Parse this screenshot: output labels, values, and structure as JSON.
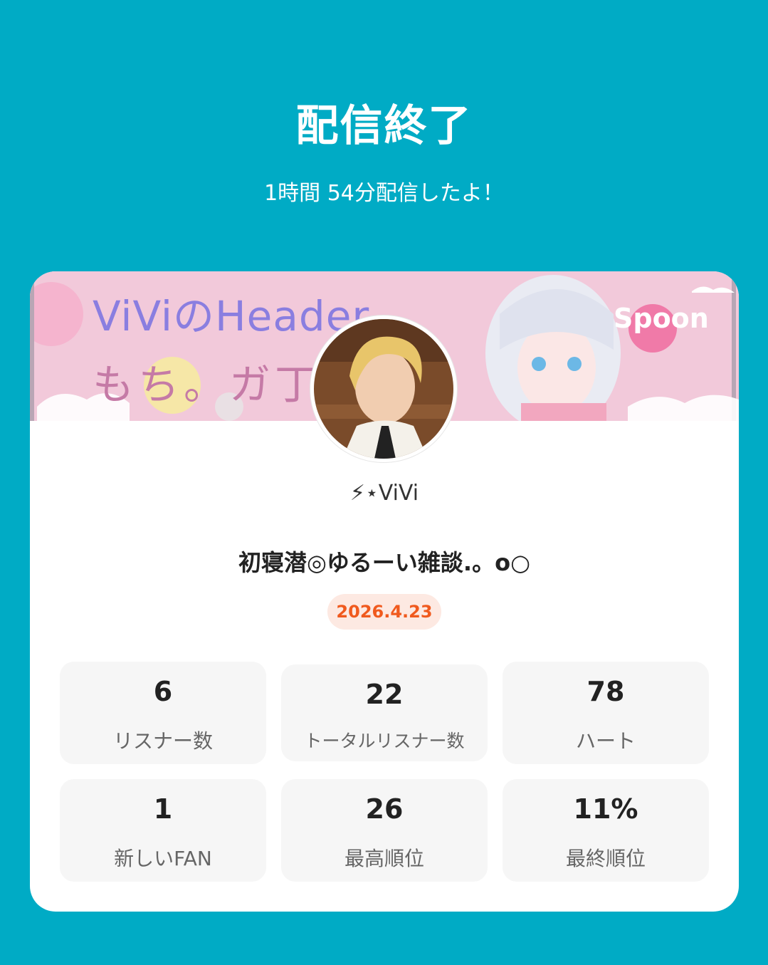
{
  "header": {
    "title": "配信終了",
    "subtitle": "1時間 54分配信したよ！"
  },
  "profile": {
    "banner_text_line1": "ViViのHeader",
    "banner_text_line2": "もち。ガ丁",
    "brand_logo": "Spoon",
    "username": "⚡︎⋆ViVi"
  },
  "live": {
    "title": "初寝潜◎ゆるーい雑談.。o○",
    "date": "2026.4.23"
  },
  "stats": [
    {
      "value": "6",
      "label": "リスナー数"
    },
    {
      "value": "22",
      "label": "トータルリスナー数"
    },
    {
      "value": "78",
      "label": "ハート"
    },
    {
      "value": "1",
      "label": "新しいFAN"
    },
    {
      "value": "26",
      "label": "最高順位"
    },
    {
      "value": "11%",
      "label": "最終順位"
    }
  ],
  "colors": {
    "background": "#00abc5",
    "card": "#ffffff",
    "date_badge_bg": "#fde9e2",
    "date_badge_text": "#f05a1e",
    "stat_bg": "#f6f6f6"
  }
}
